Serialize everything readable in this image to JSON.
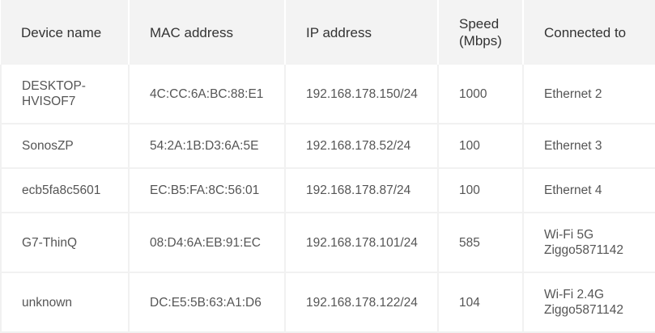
{
  "table": {
    "headers": {
      "device_name": "Device name",
      "mac_address": "MAC address",
      "ip_address": "IP address",
      "speed_line1": "Speed",
      "speed_line2": "(Mbps)",
      "connected_to": "Connected to"
    },
    "rows": [
      {
        "device_name_line1": "DESKTOP-",
        "device_name_line2": "HVISOF7",
        "mac": "4C:CC:6A:BC:88:E1",
        "ip": "192.168.178.150/24",
        "speed": "1000",
        "connected_line1": "Ethernet 2",
        "connected_line2": ""
      },
      {
        "device_name_line1": "SonosZP",
        "device_name_line2": "",
        "mac": "54:2A:1B:D3:6A:5E",
        "ip": "192.168.178.52/24",
        "speed": "100",
        "connected_line1": "Ethernet 3",
        "connected_line2": ""
      },
      {
        "device_name_line1": "ecb5fa8c5601",
        "device_name_line2": "",
        "mac": "EC:B5:FA:8C:56:01",
        "ip": "192.168.178.87/24",
        "speed": "100",
        "connected_line1": "Ethernet 4",
        "connected_line2": ""
      },
      {
        "device_name_line1": "G7-ThinQ",
        "device_name_line2": "",
        "mac": "08:D4:6A:EB:91:EC",
        "ip": "192.168.178.101/24",
        "speed": "585",
        "connected_line1": "Wi-Fi 5G",
        "connected_line2": "Ziggo5871142"
      },
      {
        "device_name_line1": "unknown",
        "device_name_line2": "",
        "mac": "DC:E5:5B:63:A1:D6",
        "ip": "192.168.178.122/24",
        "speed": "104",
        "connected_line1": "Wi-Fi 2.4G",
        "connected_line2": "Ziggo5871142"
      }
    ]
  }
}
